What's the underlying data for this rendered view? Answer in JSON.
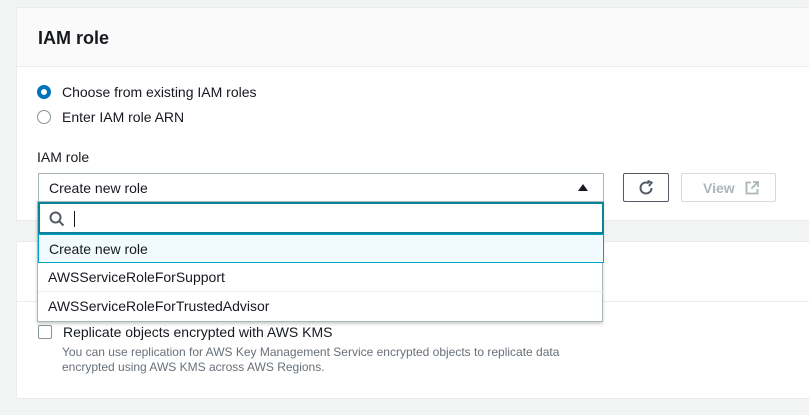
{
  "iam_panel": {
    "title": "IAM role",
    "radio_options": [
      {
        "label": "Choose from existing IAM roles",
        "checked": true
      },
      {
        "label": "Enter IAM role ARN",
        "checked": false
      }
    ],
    "field_label": "IAM role",
    "select": {
      "value": "Create new role"
    },
    "refresh_button": {
      "icon": "refresh-icon"
    },
    "view_button": {
      "label": "View",
      "icon": "external-link-icon",
      "disabled": true
    }
  },
  "dropdown": {
    "search": {
      "value": "",
      "icon": "search-icon"
    },
    "options": [
      {
        "label": "Create new role",
        "highlighted": true
      },
      {
        "label": "AWSServiceRoleForSupport",
        "highlighted": false
      },
      {
        "label": "AWSServiceRoleForTrustedAdvisor",
        "highlighted": false
      }
    ]
  },
  "kms_panel": {
    "checkbox_label": "Replicate objects encrypted with AWS KMS",
    "checkbox_checked": false,
    "description": "You can use replication for AWS Key Management Service encrypted objects to replicate data encrypted using AWS KMS across AWS Regions."
  },
  "colors": {
    "accent": "#0073bb",
    "focus": "#0a8299",
    "highlight_bg": "#f1faff"
  }
}
